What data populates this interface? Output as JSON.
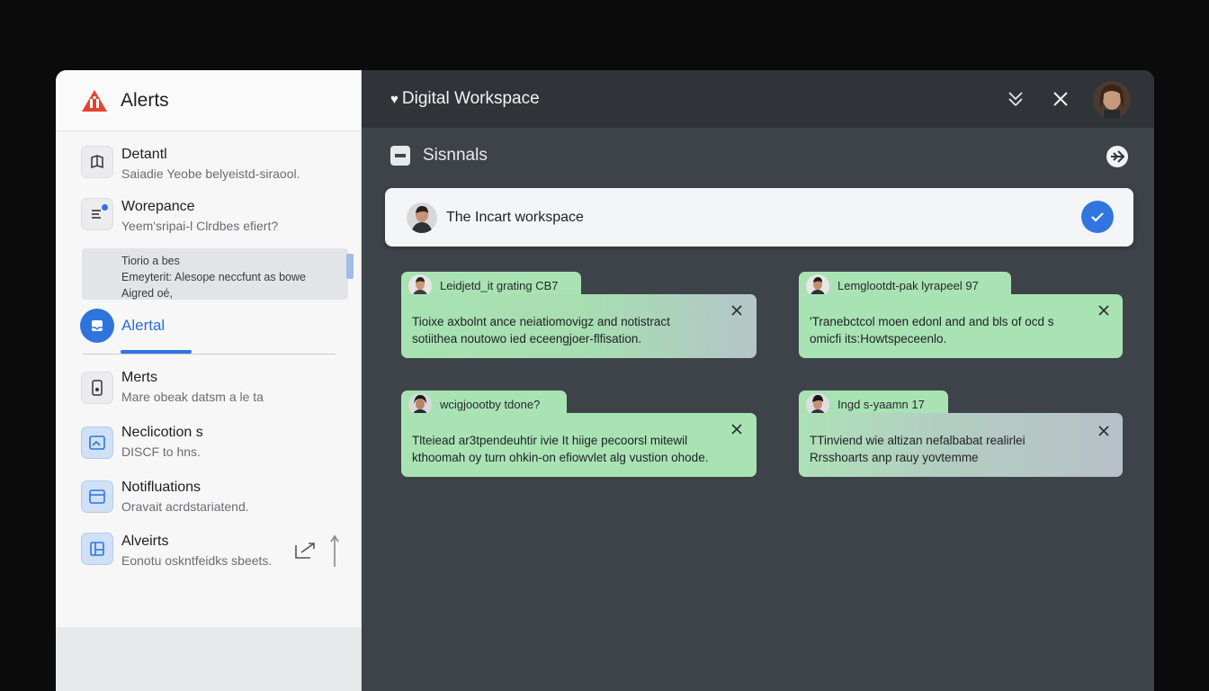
{
  "sidebar": {
    "title": "Alerts",
    "items": [
      {
        "title": "Detantl",
        "subtitle": "Saiadie Yeobe belyeistd-siraool.",
        "icon": "book-icon"
      },
      {
        "title": "Worepance",
        "subtitle": "Yeem'sripai-l Clrdbes efiert?",
        "icon": "list-icon"
      }
    ],
    "tip": {
      "line1": "Tiorio a bes",
      "line2": "Emeyterit: Alesope neccfunt as bowe",
      "line3": "Aigred oé,"
    },
    "active": {
      "label": "Alertal",
      "icon": "inbox-icon"
    },
    "lower_items": [
      {
        "title": "Merts",
        "subtitle": "Mare obeak datsm a le ta",
        "icon": "tablet-icon"
      },
      {
        "title": "Neclicotion s",
        "subtitle": "DISCF to hns.",
        "icon": "image-icon"
      },
      {
        "title": "Notifluations",
        "subtitle": "Oravait acrdstariatend.",
        "icon": "window-icon"
      },
      {
        "title": "Alveirts",
        "subtitle": "Eonotu oskntfeidks sbeets.",
        "icon": "layout-icon"
      }
    ]
  },
  "topbar": {
    "brand": "Digital Workspace",
    "brand_icon": "heart-icon"
  },
  "subbar": {
    "label": "Sisnnals"
  },
  "banner": {
    "text": "The Incart workspace"
  },
  "cards": [
    {
      "tab": "Leidjetd_it grating CB7",
      "line1": "Tioixe axbolnt ance neiatiomovigz and notistract",
      "line2": "sotiithea noutowo ied eceengjoer-flfisation."
    },
    {
      "tab": "Lemglootdt-pak lyrapeel 97",
      "line1": "'Tranebctcol moen edonl and and bls of ocd s",
      "line2": "omicfi its:Howtspeceenlo."
    },
    {
      "tab": "wcigjoootby tdone?",
      "line1": "Tlteiead ar3tpendeuhtir ivie It hiige pecoorsl mitewil",
      "line2": "kthoomah oy turn ohkin-on efiowvlet alg vustion ohode."
    },
    {
      "tab": "Ingd s-yaamn 17",
      "line1": "TTinviend wie altizan nefalbabat realirlei",
      "line2": "Rrsshoarts anp rauy yovtemme"
    }
  ],
  "colors": {
    "accent": "#2f74dc",
    "card_green": "#a9e3b4",
    "main_bg": "#3e4349",
    "topbar_bg": "#303439"
  }
}
